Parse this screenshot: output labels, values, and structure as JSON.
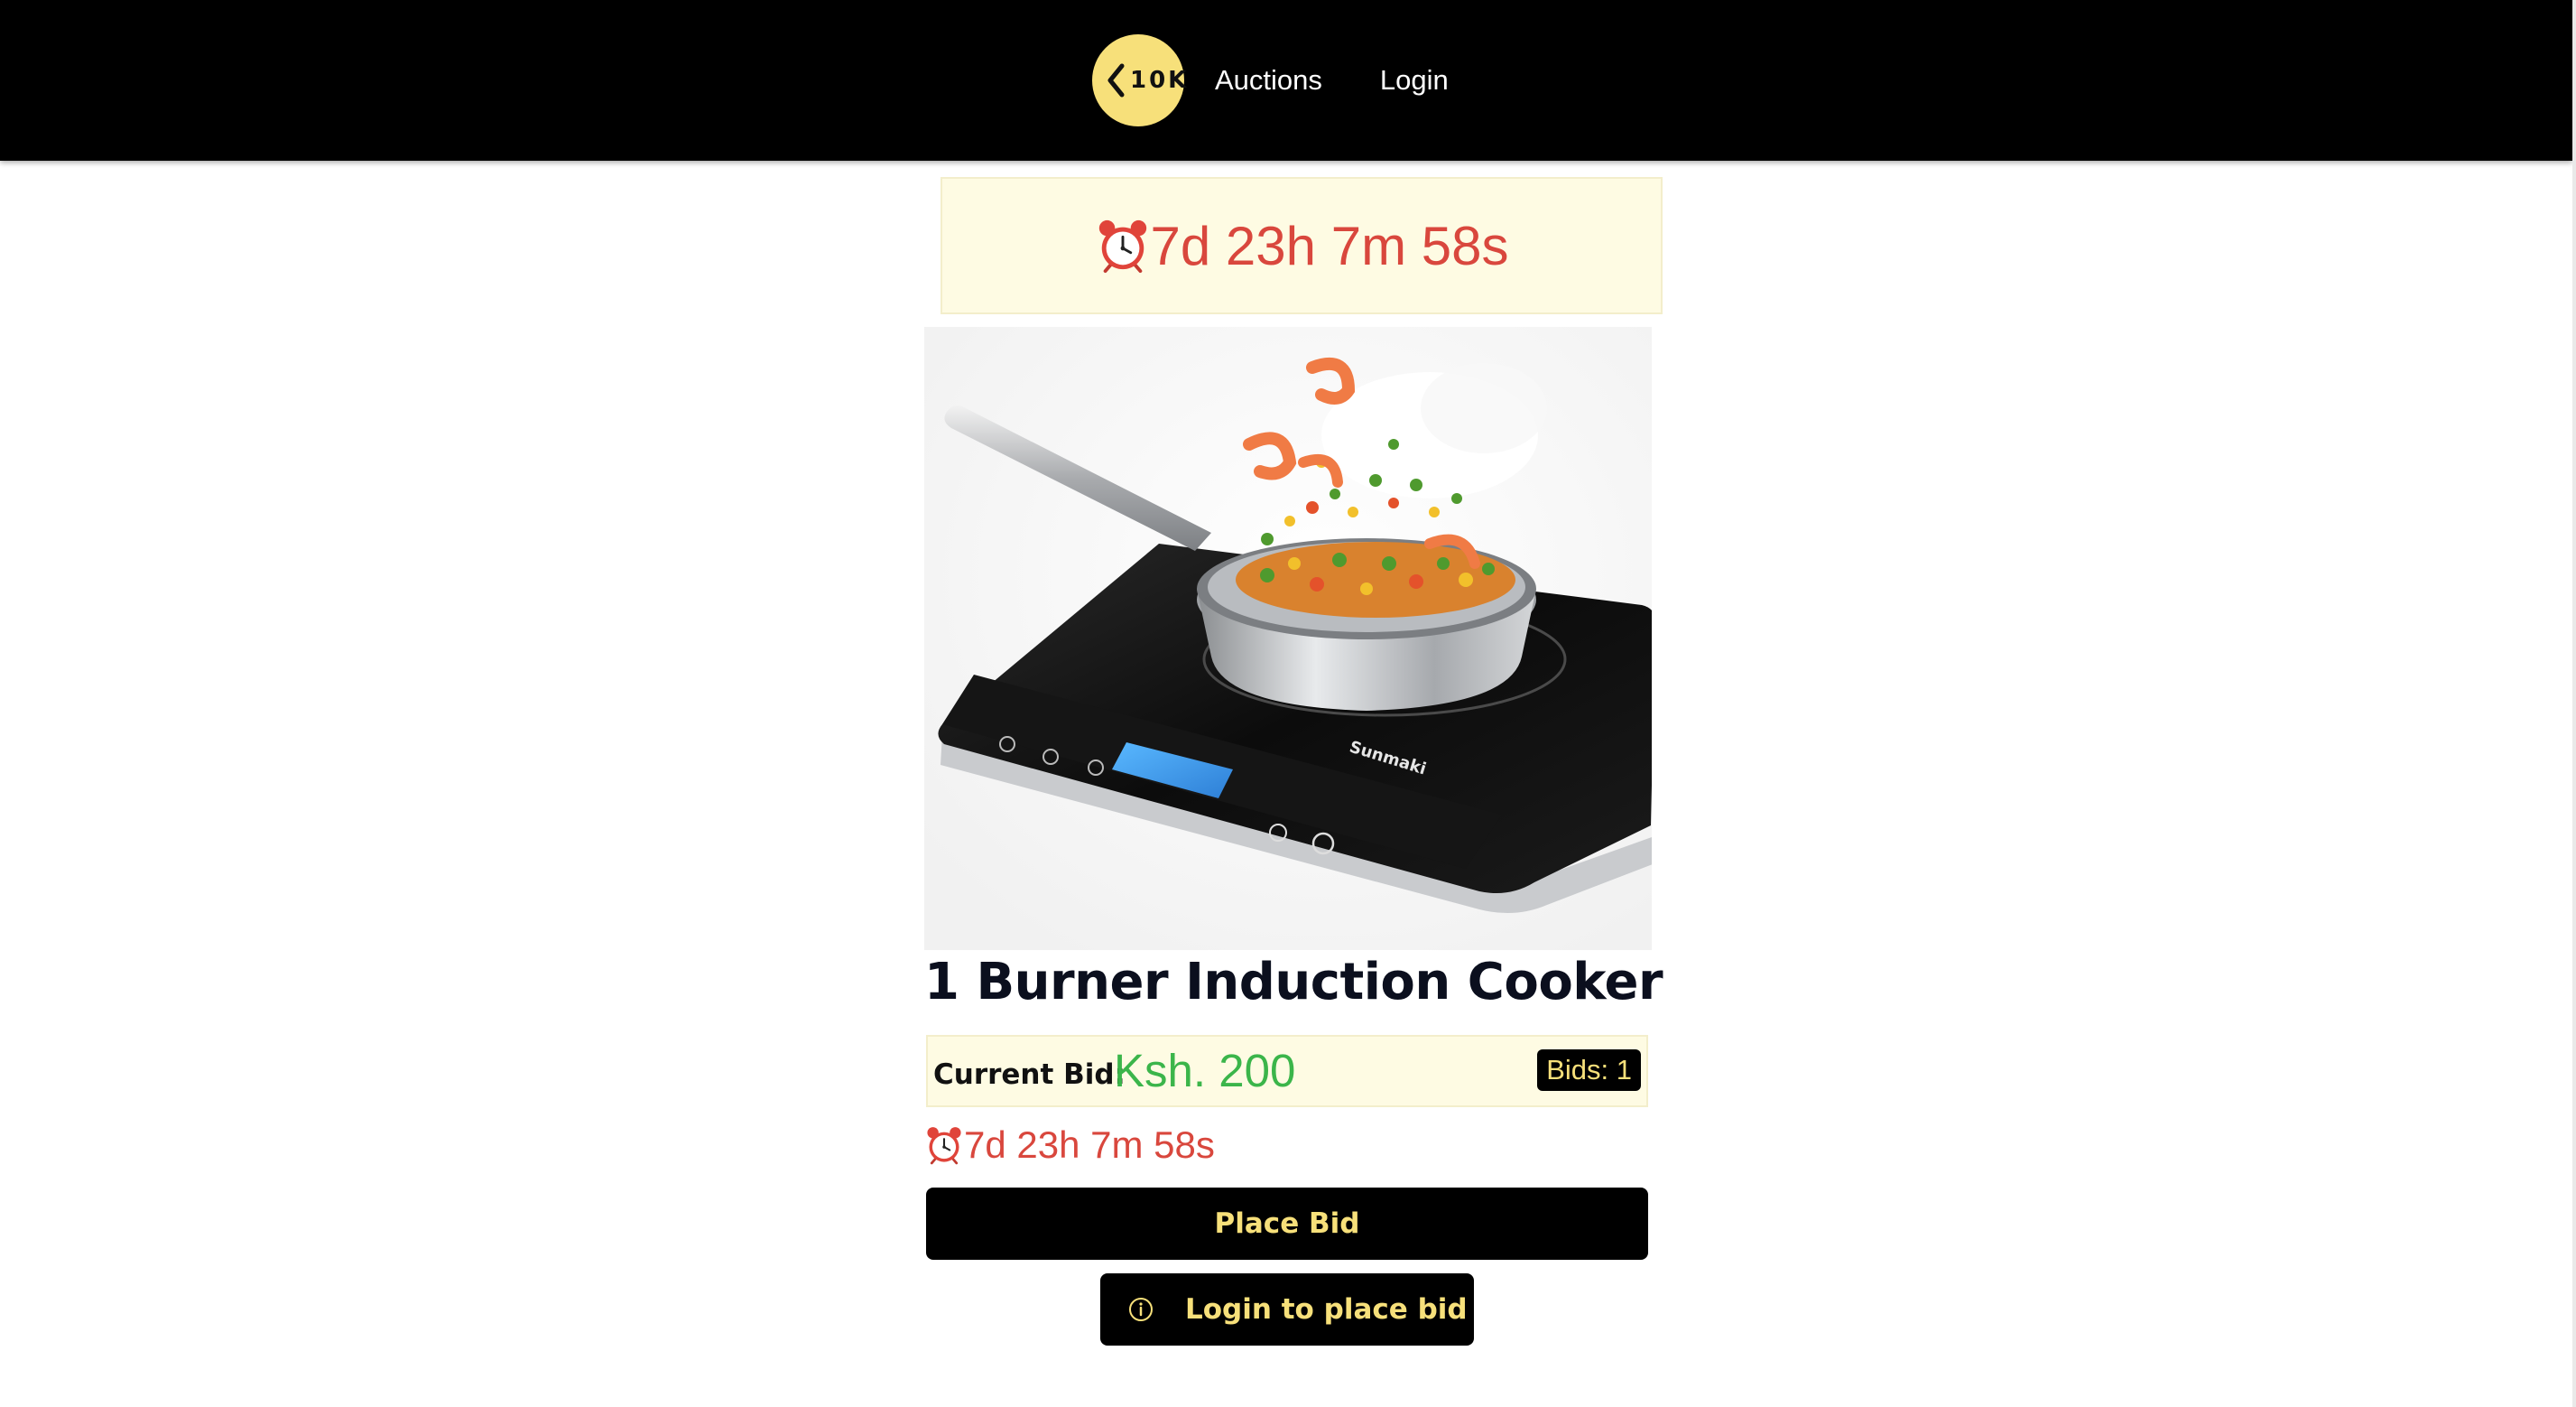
{
  "header": {
    "logo_text": "10K",
    "nav": [
      {
        "label": "Auctions"
      },
      {
        "label": "Login"
      }
    ]
  },
  "banner": {
    "timer": "7d 23h 7m 58s",
    "icon": "alarm-clock-icon"
  },
  "product": {
    "image": "induction-cooker-with-pan-image",
    "title": "1 Burner Induction Cooker",
    "current_bid_label": "Current Bid:",
    "current_bid_value": "Ksh. 200",
    "bids_badge": "Bids: 1",
    "timer": "7d 23h 7m 58s"
  },
  "actions": {
    "place_bid": "Place Bid",
    "login_to_bid": "Login to place bid",
    "info_icon": "info-icon"
  },
  "colors": {
    "accent_yellow": "#f7e07a",
    "timer_red": "#d9473d",
    "bid_green": "#3bb54a",
    "banner_bg": "#fefbe3"
  }
}
